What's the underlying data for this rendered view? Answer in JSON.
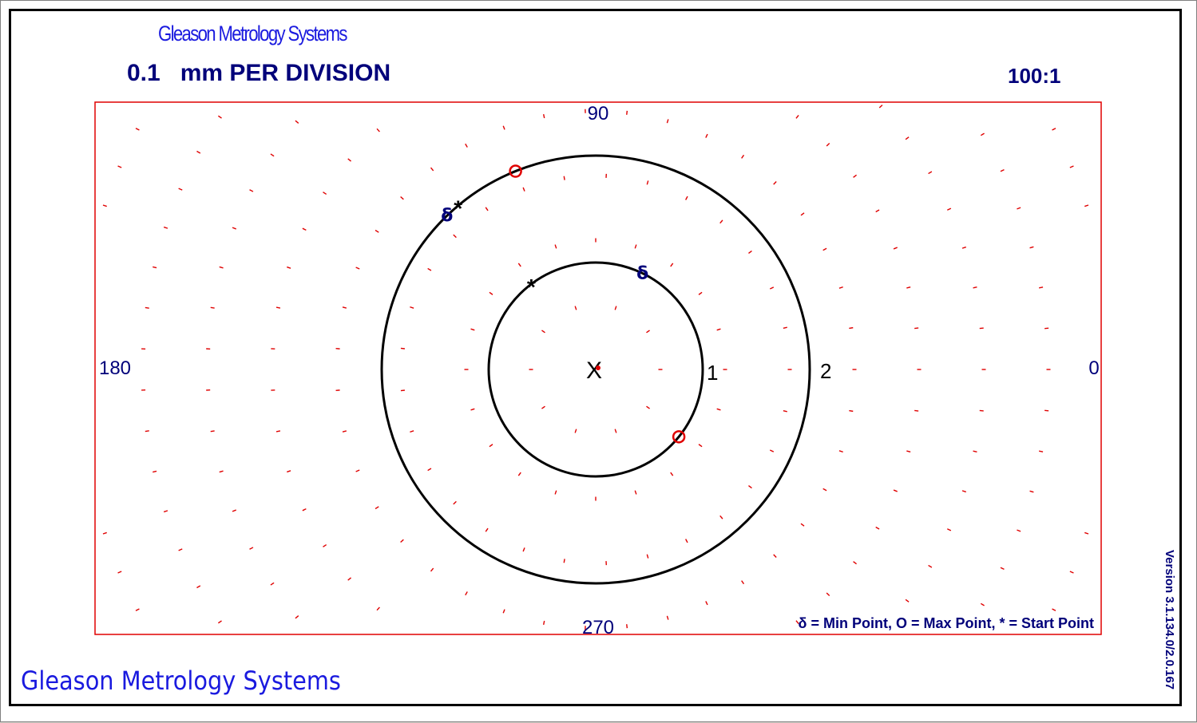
{
  "header": {
    "brand": "Gleason Metrology Systems",
    "scale": "0.1   mm PER DIVISION",
    "ratio": "100:1"
  },
  "footer": {
    "brand": "Gleason Metrology Systems",
    "version": "Version 3.1.134.0/2.0.167"
  },
  "chart_data": {
    "type": "polar",
    "angle_labels": {
      "a0": "0",
      "a90": "90",
      "a180": "180",
      "a270": "270"
    },
    "ring_labels": [
      "1",
      "2"
    ],
    "legend": "δ = Min Point, O = Max Point, * = Start Point",
    "center_marker": "X",
    "units_per_division": 0.1,
    "series": [
      {
        "name": "1",
        "min_point_angle_deg": 64,
        "max_point_angle_deg": -39,
        "start_point_angle_deg": 127
      },
      {
        "name": "2",
        "min_point_angle_deg": 134,
        "max_point_angle_deg": 112,
        "start_point_angle_deg": 130
      }
    ],
    "colors": {
      "grid": "#e00000",
      "trace": "#000000",
      "axis_text": "#00007a",
      "max_marker": "#e00000",
      "min_marker": "#00007a"
    }
  }
}
